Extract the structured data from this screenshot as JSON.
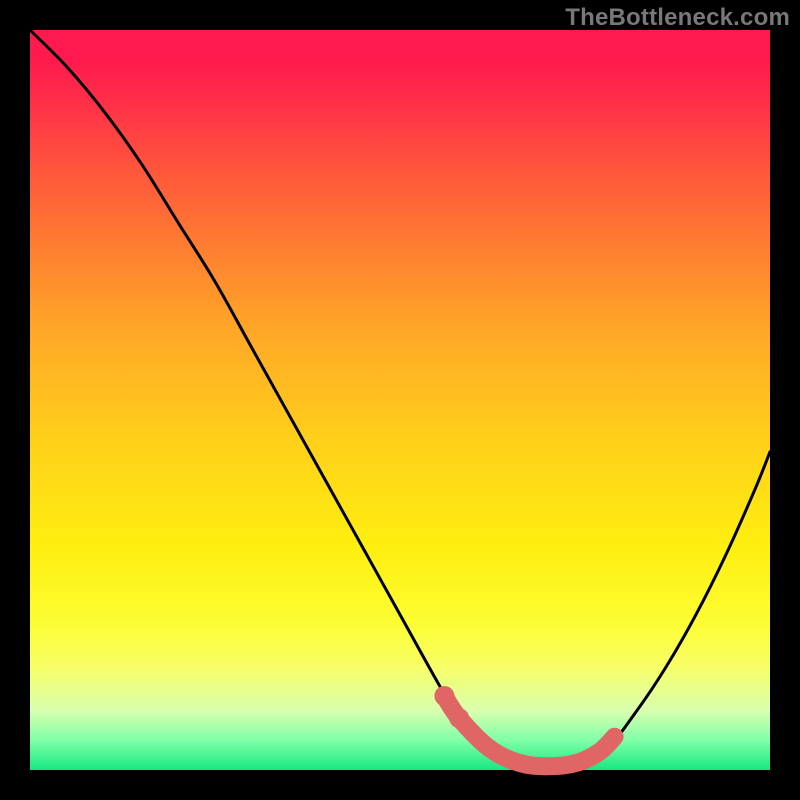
{
  "watermark": "TheBottleneck.com",
  "colors": {
    "background": "#000000",
    "curve": "#000000",
    "marker": "#e06666",
    "gradient_top": "#ff1a4d",
    "gradient_bottom": "#17e880"
  },
  "chart_data": {
    "type": "line",
    "title": "",
    "xlabel": "",
    "ylabel": "",
    "xlim": [
      0,
      100
    ],
    "ylim": [
      0,
      100
    ],
    "grid": false,
    "series": [
      {
        "name": "bottleneck-curve",
        "x": [
          0,
          5,
          10,
          15,
          20,
          25,
          30,
          35,
          40,
          45,
          50,
          55,
          58,
          62,
          66,
          70,
          74,
          78,
          82,
          86,
          90,
          94,
          98,
          100
        ],
        "values": [
          100,
          95,
          89,
          82,
          74,
          66,
          57,
          48,
          39,
          30,
          21,
          12,
          7,
          3,
          1,
          0.5,
          1,
          3,
          8,
          14,
          21,
          29,
          38,
          43
        ]
      }
    ],
    "markers": {
      "name": "highlight-band",
      "points": [
        {
          "x": 56,
          "y": 10
        },
        {
          "x": 58,
          "y": 7
        },
        {
          "x": 62,
          "y": 3
        },
        {
          "x": 66,
          "y": 1
        },
        {
          "x": 70,
          "y": 0.5
        },
        {
          "x": 74,
          "y": 1
        },
        {
          "x": 77,
          "y": 2.5
        },
        {
          "x": 79,
          "y": 4.5
        }
      ]
    }
  }
}
